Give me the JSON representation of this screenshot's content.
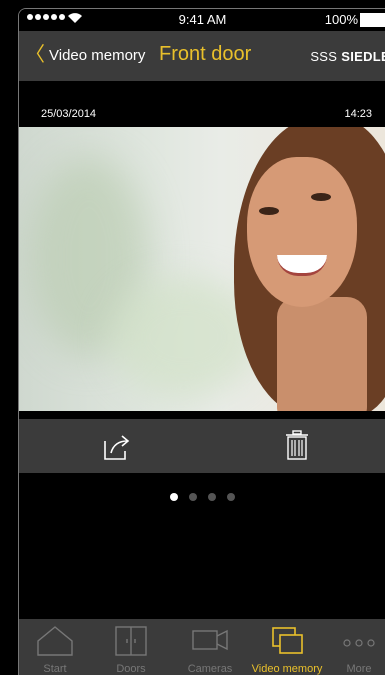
{
  "status_bar": {
    "time": "9:41 AM",
    "battery": "100%"
  },
  "nav": {
    "back_label": "Video memory",
    "title": "Front door",
    "brand_prefix": "SSS",
    "brand_name": "SIEDLE"
  },
  "recording": {
    "date": "25/03/2014",
    "time": "14:23"
  },
  "pager": {
    "total": 4,
    "current": 1
  },
  "tabs": [
    {
      "label": "Start",
      "icon": "house-icon",
      "active": false
    },
    {
      "label": "Doors",
      "icon": "door-icon",
      "active": false
    },
    {
      "label": "Cameras",
      "icon": "camera-icon",
      "active": false
    },
    {
      "label": "Video memory",
      "icon": "video-memory-icon",
      "active": true
    },
    {
      "label": "More",
      "icon": "more-icon",
      "active": false
    }
  ],
  "colors": {
    "accent": "#e9c02b",
    "bar": "#3b3b3b",
    "inactive": "#777777"
  }
}
